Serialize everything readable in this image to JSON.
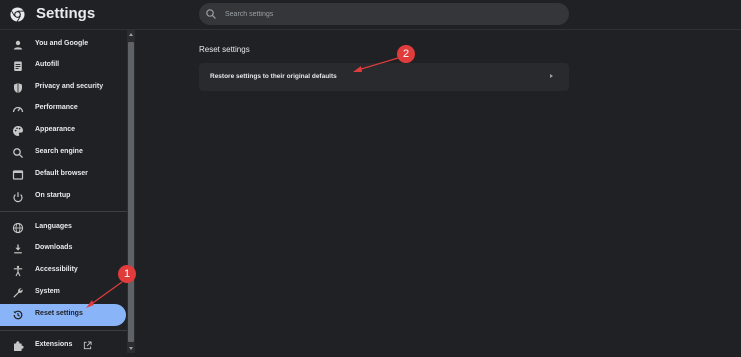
{
  "header": {
    "title": "Settings",
    "search_placeholder": "Search settings"
  },
  "sidebar": {
    "items": [
      {
        "label": "You and Google",
        "icon": "person-icon"
      },
      {
        "label": "Autofill",
        "icon": "clipboard-icon"
      },
      {
        "label": "Privacy and security",
        "icon": "shield-icon"
      },
      {
        "label": "Performance",
        "icon": "speedometer-icon"
      },
      {
        "label": "Appearance",
        "icon": "palette-icon"
      },
      {
        "label": "Search engine",
        "icon": "search-icon"
      },
      {
        "label": "Default browser",
        "icon": "browser-window-icon"
      },
      {
        "label": "On startup",
        "icon": "power-icon"
      },
      {
        "label": "Languages",
        "icon": "globe-icon"
      },
      {
        "label": "Downloads",
        "icon": "download-icon"
      },
      {
        "label": "Accessibility",
        "icon": "accessibility-icon"
      },
      {
        "label": "System",
        "icon": "wrench-icon"
      },
      {
        "label": "Reset settings",
        "icon": "history-icon",
        "selected": true
      },
      {
        "label": "Extensions",
        "icon": "puzzle-icon"
      }
    ]
  },
  "main": {
    "section_title": "Reset settings",
    "restore_label": "Restore settings to their original defaults"
  },
  "annotations": {
    "badge_1": "1",
    "badge_2": "2",
    "color": "#e03c3c"
  },
  "colors": {
    "accent": "#8ab4f8",
    "background": "#202124"
  }
}
